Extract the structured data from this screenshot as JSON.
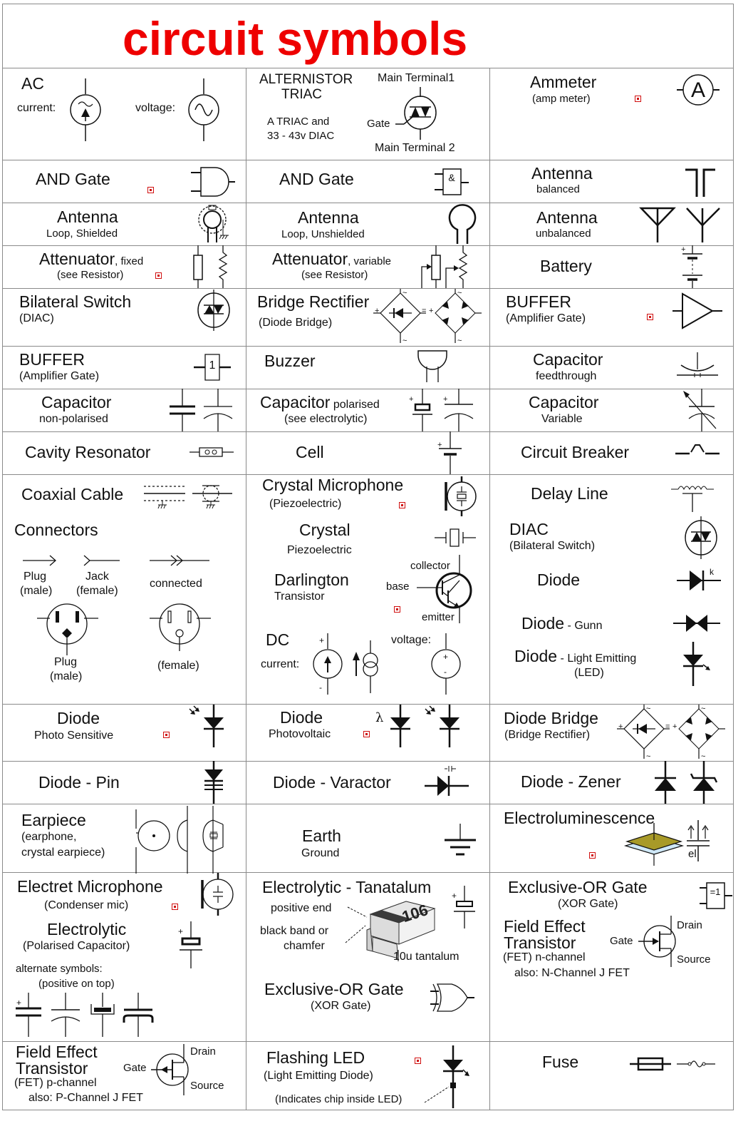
{
  "title": "circuit symbols",
  "colors": {
    "title": "#ee0000",
    "grid": "#8a8a8a",
    "marker": "#d01010",
    "electroluminescence_panel": "#a89a28"
  },
  "cells": {
    "ac": {
      "name": "AC",
      "current_label": "current:",
      "voltage_label": "voltage:"
    },
    "alternistor": {
      "name": "ALTERNISTOR",
      "name2": "TRIAC",
      "note1": "A TRIAC and",
      "note2": "33 - 43v DIAC",
      "mt1": "Main Terminal1",
      "gate": "Gate",
      "mt2": "Main Terminal 2"
    },
    "ammeter": {
      "name": "Ammeter",
      "sub": "(amp meter)",
      "glyph": "A"
    },
    "and_gate1": {
      "name": "AND Gate"
    },
    "and_gate2": {
      "name": "AND Gate",
      "glyph": "&"
    },
    "antenna_balanced": {
      "name": "Antenna",
      "sub": "balanced"
    },
    "antenna_loop_shielded": {
      "name": "Antenna",
      "sub": "Loop, Shielded"
    },
    "antenna_loop_unshielded": {
      "name": "Antenna",
      "sub": "Loop, Unshielded"
    },
    "antenna_unbalanced": {
      "name": "Antenna",
      "sub": "unbalanced"
    },
    "attenuator_fixed": {
      "name": "Attenuator",
      "qualifier": ", fixed",
      "sub": "(see Resistor)"
    },
    "attenuator_variable": {
      "name": "Attenuator",
      "qualifier": ", variable",
      "sub": "(see Resistor)"
    },
    "battery": {
      "name": "Battery",
      "plus": "+"
    },
    "bilateral_switch": {
      "name": "Bilateral Switch",
      "sub": "(DIAC)"
    },
    "bridge_rectifier": {
      "name": "Bridge Rectifier",
      "sub": "(Diode Bridge)",
      "plus": "+",
      "minus": "=",
      "ac": "~"
    },
    "buffer1": {
      "name": "BUFFER",
      "sub": "(Amplifier Gate)"
    },
    "buffer2": {
      "name": "BUFFER",
      "sub": "(Amplifier Gate)",
      "glyph": "1"
    },
    "buzzer": {
      "name": "Buzzer"
    },
    "capacitor_feedthrough": {
      "name": "Capacitor",
      "sub": "feedthrough"
    },
    "capacitor_nonpolarised": {
      "name": "Capacitor",
      "sub": "non-polarised"
    },
    "capacitor_polarised": {
      "name": "Capacitor",
      "qualifier": " polarised",
      "sub": "(see electrolytic)",
      "plus": "+"
    },
    "capacitor_variable": {
      "name": "Capacitor",
      "sub": "Variable"
    },
    "cavity_resonator": {
      "name": "Cavity Resonator"
    },
    "cell": {
      "name": "Cell",
      "plus": "+"
    },
    "circuit_breaker": {
      "name": "Circuit Breaker"
    },
    "coaxial_cable": {
      "name": "Coaxial Cable"
    },
    "connectors": {
      "name": "Connectors",
      "plug": "Plug",
      "plug_sub": "(male)",
      "jack": "Jack",
      "jack_sub": "(female)",
      "connected": "connected",
      "plug2": "Plug",
      "plug2_sub": "(male)",
      "female": "(female)"
    },
    "crystal_microphone": {
      "name": "Crystal Microphone",
      "sub": "(Piezoelectric)"
    },
    "crystal": {
      "name": "Crystal",
      "sub": "Piezoelectric"
    },
    "darlington": {
      "name": "Darlington",
      "sub": "Transistor",
      "collector": "collector",
      "base": "base",
      "emitter": "emitter"
    },
    "dc": {
      "name": "DC",
      "current_label": "current:",
      "voltage_label": "voltage:",
      "plus": "+",
      "minus": "-"
    },
    "delay_line": {
      "name": "Delay Line"
    },
    "diac": {
      "name": "DIAC",
      "sub": "(Bilateral Switch)"
    },
    "diode": {
      "name": "Diode",
      "k": "k"
    },
    "diode_gunn": {
      "name": "Diode",
      "qualifier": " - Gunn"
    },
    "diode_led": {
      "name": "Diode",
      "qualifier": " - Light Emitting",
      "sub": "(LED)"
    },
    "diode_photo": {
      "name": "Diode",
      "sub": "Photo Sensitive"
    },
    "diode_photovoltaic": {
      "name": "Diode",
      "sub": "Photovoltaic",
      "lambda": "λ"
    },
    "diode_bridge": {
      "name": "Diode Bridge",
      "sub": "(Bridge Rectifier)",
      "plus": "+",
      "minus": "=",
      "ac": "~"
    },
    "diode_pin": {
      "name": "Diode - Pin"
    },
    "diode_varactor": {
      "name": "Diode - Varactor"
    },
    "diode_zener": {
      "name": "Diode - Zener"
    },
    "earpiece": {
      "name": "Earpiece",
      "sub1": "(earphone,",
      "sub2": "crystal earpiece)"
    },
    "earth": {
      "name": "Earth",
      "sub": "Ground"
    },
    "electroluminescence": {
      "name": "Electroluminescence",
      "el": "el"
    },
    "electret_mic": {
      "name": "Electret Microphone",
      "sub": "(Condenser mic)"
    },
    "electrolytic": {
      "name": "Electrolytic",
      "sub": "(Polarised Capacitor)",
      "alt1": "alternate symbols:",
      "alt2": "(positive on top)",
      "plus": "+"
    },
    "tantalum": {
      "name": "Electrolytic  - Tanatalum",
      "positive_end": "positive end",
      "band1": "black band or",
      "band2": "chamfer",
      "value": "10u tantalum",
      "code": "106",
      "plus": "+"
    },
    "xor_gate1": {
      "name": "Exclusive-OR Gate",
      "sub": "(XOR Gate)"
    },
    "xor_gate2": {
      "name": "Exclusive-OR Gate",
      "sub": "(XOR Gate)",
      "glyph": "=1"
    },
    "fet_n": {
      "name1": "Field Effect",
      "name2": "Transistor",
      "sub": "(FET) n-channel",
      "also": "also: N-Channel J FET",
      "gate": "Gate",
      "drain": "Drain",
      "source": "Source"
    },
    "fet_p": {
      "name1": "Field Effect",
      "name2": "Transistor",
      "sub": "(FET) p-channel",
      "also": "also: P-Channel J FET",
      "gate": "Gate",
      "drain": "Drain",
      "source": "Source"
    },
    "flashing_led": {
      "name": "Flashing LED",
      "sub": "(Light Emitting Diode)",
      "note": "(Indicates chip inside LED)"
    },
    "fuse": {
      "name": "Fuse"
    }
  }
}
